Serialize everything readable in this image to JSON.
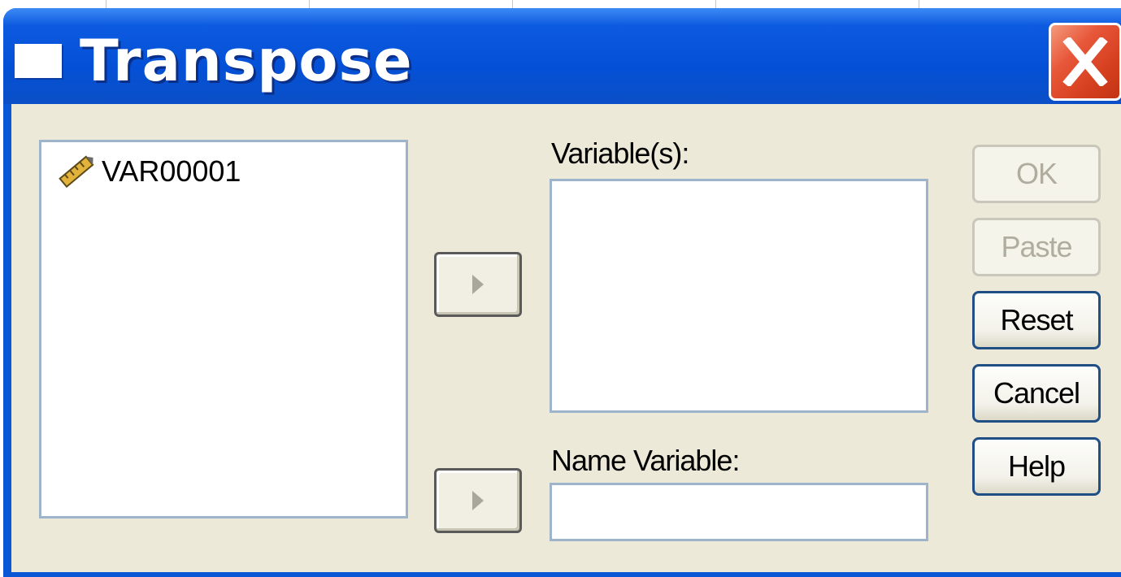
{
  "window": {
    "title": "Transpose",
    "close_label": "X"
  },
  "source_list": {
    "items": [
      {
        "label": "VAR00001",
        "icon": "ruler-pencil-icon"
      }
    ]
  },
  "variables": {
    "label": "Variable(s):",
    "value": ""
  },
  "name_variable": {
    "label": "Name Variable:",
    "value": ""
  },
  "buttons": {
    "ok": "OK",
    "paste": "Paste",
    "reset": "Reset",
    "cancel": "Cancel",
    "help": "Help"
  },
  "colors": {
    "titlebar": "#0450d6",
    "close": "#d5401f",
    "dialog_face": "#ece9d8",
    "button_border": "#1f4f85",
    "field_border": "#9eb4cb"
  }
}
